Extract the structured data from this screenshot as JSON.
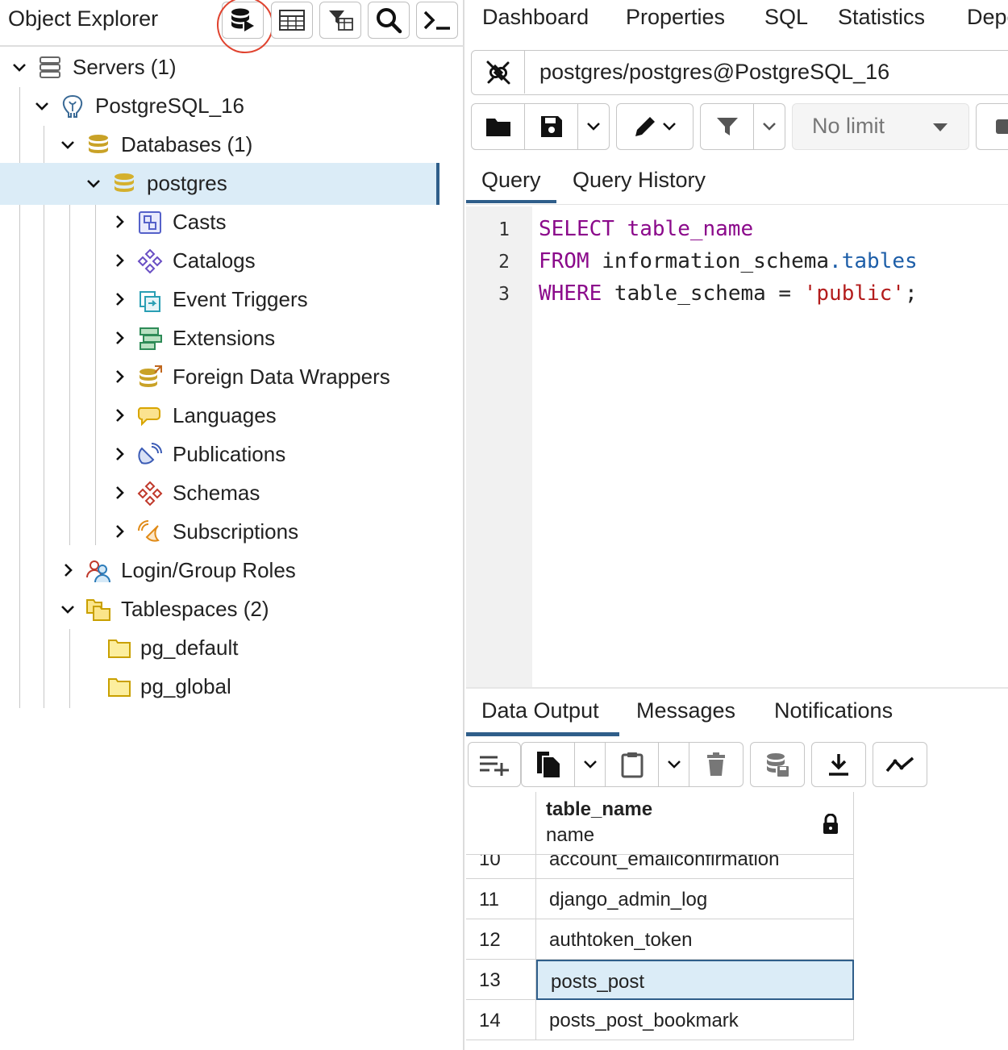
{
  "object_explorer": {
    "title": "Object Explorer",
    "toolbar": [
      {
        "name": "query-tool-icon"
      },
      {
        "name": "view-data-icon"
      },
      {
        "name": "filtered-rows-icon"
      },
      {
        "name": "search-objects-icon"
      },
      {
        "name": "psql-tool-icon"
      }
    ],
    "tree": [
      {
        "label": "Servers (1)",
        "expanded": true,
        "icon": "servers-icon"
      },
      {
        "label": "PostgreSQL_16",
        "expanded": true,
        "icon": "postgresql-elephant-icon"
      },
      {
        "label": "Databases (1)",
        "expanded": true,
        "icon": "databases-icon"
      },
      {
        "label": "postgres",
        "expanded": true,
        "icon": "database-icon",
        "selected": true
      },
      {
        "label": "Casts",
        "expanded": false,
        "icon": "casts-icon"
      },
      {
        "label": "Catalogs",
        "expanded": false,
        "icon": "catalogs-icon"
      },
      {
        "label": "Event Triggers",
        "expanded": false,
        "icon": "event-triggers-icon"
      },
      {
        "label": "Extensions",
        "expanded": false,
        "icon": "extensions-icon"
      },
      {
        "label": "Foreign Data Wrappers",
        "expanded": false,
        "icon": "foreign-data-wrappers-icon"
      },
      {
        "label": "Languages",
        "expanded": false,
        "icon": "languages-icon"
      },
      {
        "label": "Publications",
        "expanded": false,
        "icon": "publications-icon"
      },
      {
        "label": "Schemas",
        "expanded": false,
        "icon": "schemas-icon"
      },
      {
        "label": "Subscriptions",
        "expanded": false,
        "icon": "subscriptions-icon"
      },
      {
        "label": "Login/Group Roles",
        "expanded": false,
        "icon": "login-group-roles-icon"
      },
      {
        "label": "Tablespaces (2)",
        "expanded": true,
        "icon": "tablespaces-icon"
      },
      {
        "label": "pg_default",
        "icon": "folder-icon"
      },
      {
        "label": "pg_global",
        "icon": "folder-icon"
      }
    ]
  },
  "top_tabs": [
    "Dashboard",
    "Properties",
    "SQL",
    "Statistics",
    "Dependencies"
  ],
  "connection": {
    "label": "postgres/postgres@PostgreSQL_16"
  },
  "query_toolbar": {
    "limit_label": "No limit"
  },
  "query_tabs": [
    "Query",
    "Query History"
  ],
  "editor": {
    "line_numbers": [
      "1",
      "2",
      "3"
    ],
    "lines": [
      "SELECT table_name",
      "FROM information_schema.tables",
      "WHERE table_schema = 'public';"
    ]
  },
  "output_tabs": [
    "Data Output",
    "Messages",
    "Notifications"
  ],
  "grid": {
    "column": {
      "name": "table_name",
      "type": "name"
    },
    "rows": [
      {
        "num": "10",
        "value": "account_emailconfirmation"
      },
      {
        "num": "11",
        "value": "django_admin_log"
      },
      {
        "num": "12",
        "value": "authtoken_token"
      },
      {
        "num": "13",
        "value": "posts_post",
        "selected": true
      },
      {
        "num": "14",
        "value": "posts_post_bookmark"
      }
    ]
  },
  "colors": {
    "accent": "#2f5e8a",
    "selection": "#dbecf7",
    "keyword": "#8b0a8b",
    "string": "#b31c1c",
    "annotation_circle": "#e0432f"
  }
}
